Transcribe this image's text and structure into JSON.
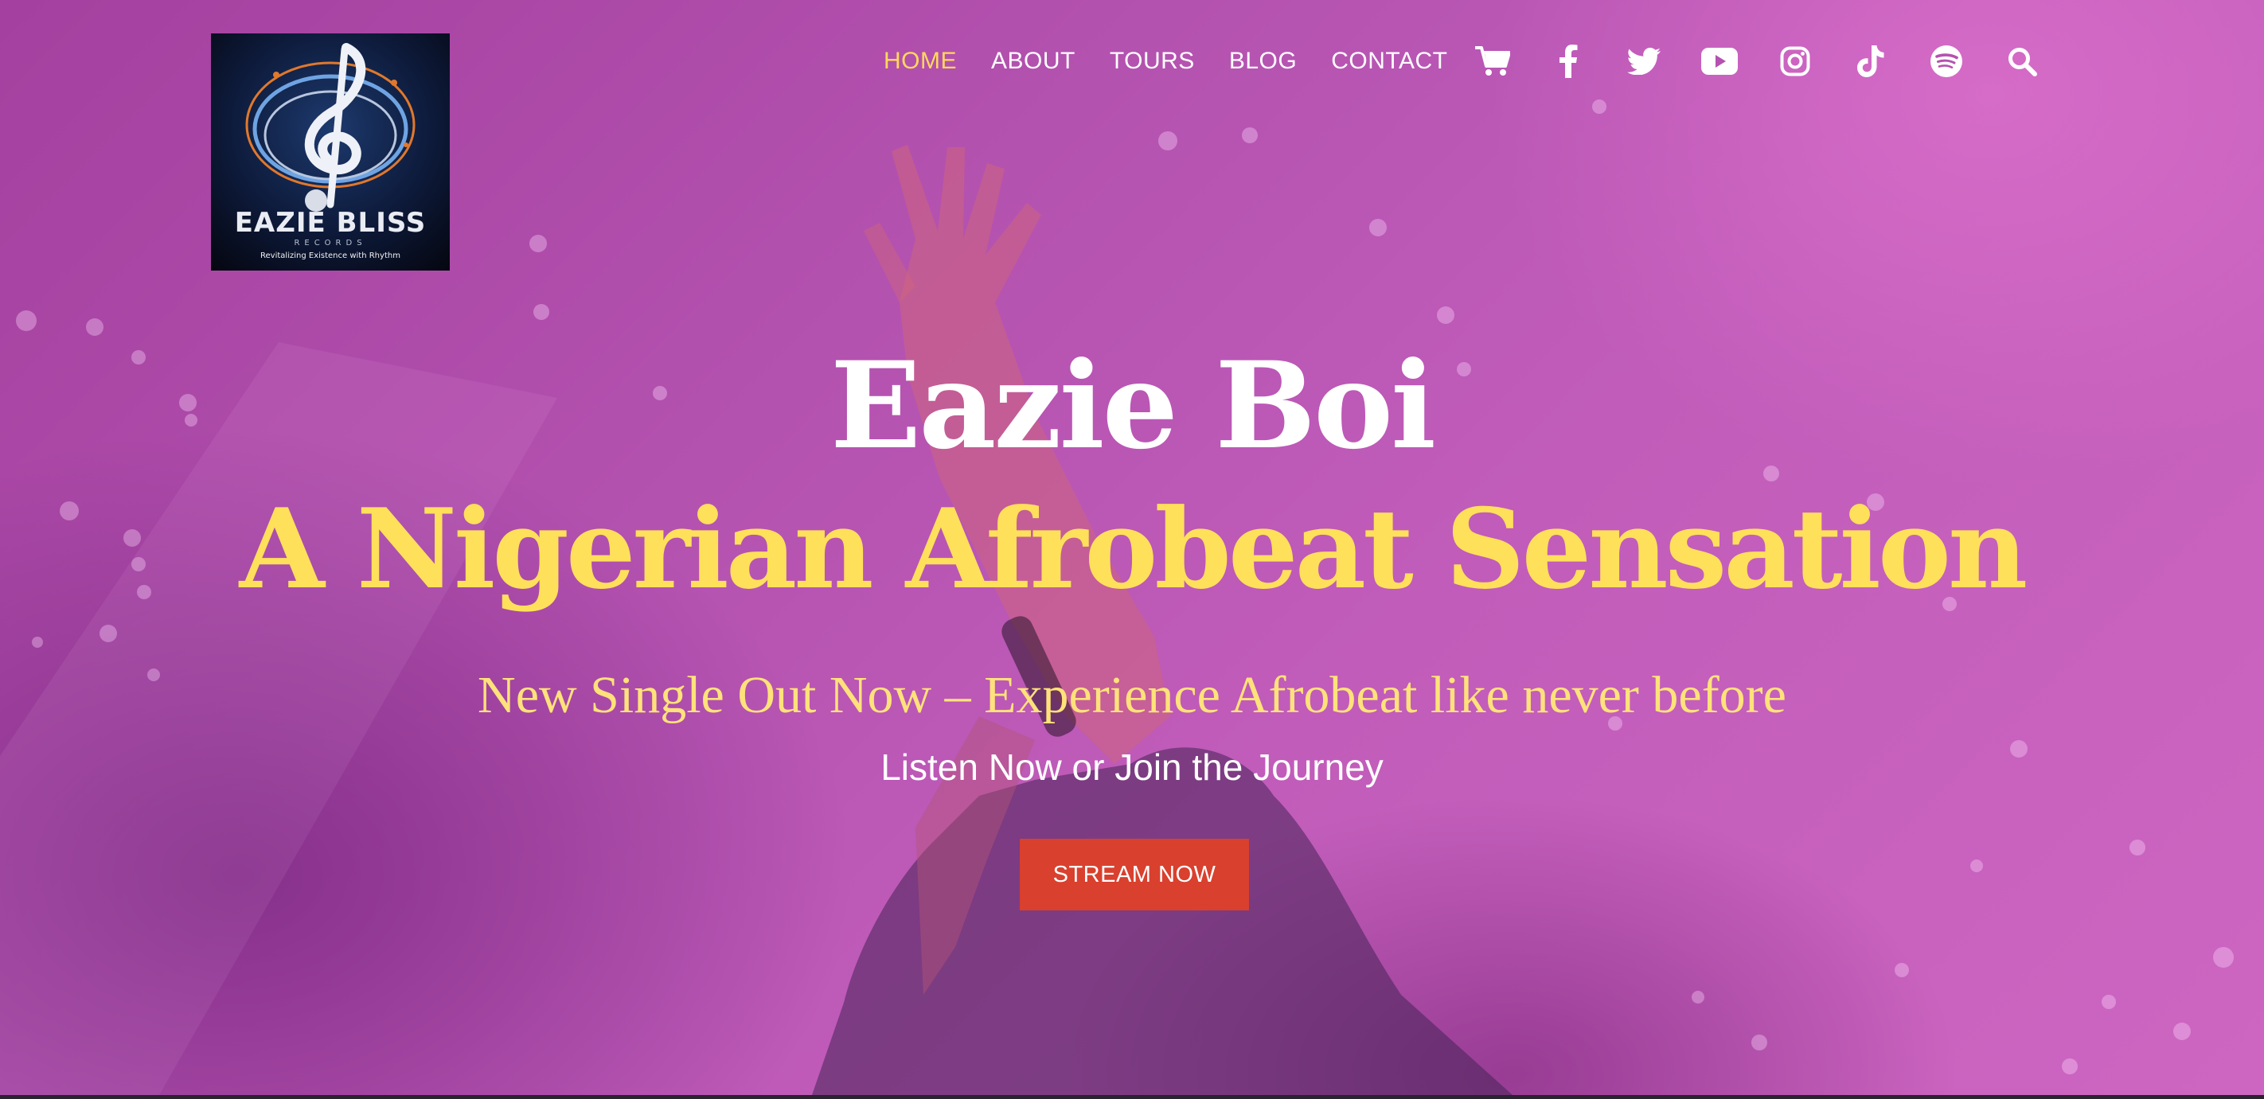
{
  "logo": {
    "name": "EAZIE BLISS",
    "sub": "RECORDS",
    "tagline": "Revitalizing Existence with Rhythm"
  },
  "nav": {
    "items": [
      {
        "label": "HOME",
        "active": true
      },
      {
        "label": "ABOUT",
        "active": false
      },
      {
        "label": "TOURS",
        "active": false
      },
      {
        "label": "BLOG",
        "active": false
      },
      {
        "label": "CONTACT",
        "active": false
      }
    ],
    "icons": [
      "cart-icon",
      "facebook-icon",
      "twitter-icon",
      "youtube-icon",
      "instagram-icon",
      "tiktok-icon",
      "spotify-icon",
      "search-icon"
    ]
  },
  "hero": {
    "title": "Eazie Boi",
    "headline": "A Nigerian Afrobeat Sensation",
    "subtitle": "New Single Out Now – Experience Afrobeat like never before",
    "tagline": "Listen Now or Join the Journey",
    "cta_label": "STREAM NOW"
  },
  "colors": {
    "accent_yellow": "#ffe05a",
    "cta_red": "#d9402e",
    "background_magenta": "#b452b0"
  }
}
